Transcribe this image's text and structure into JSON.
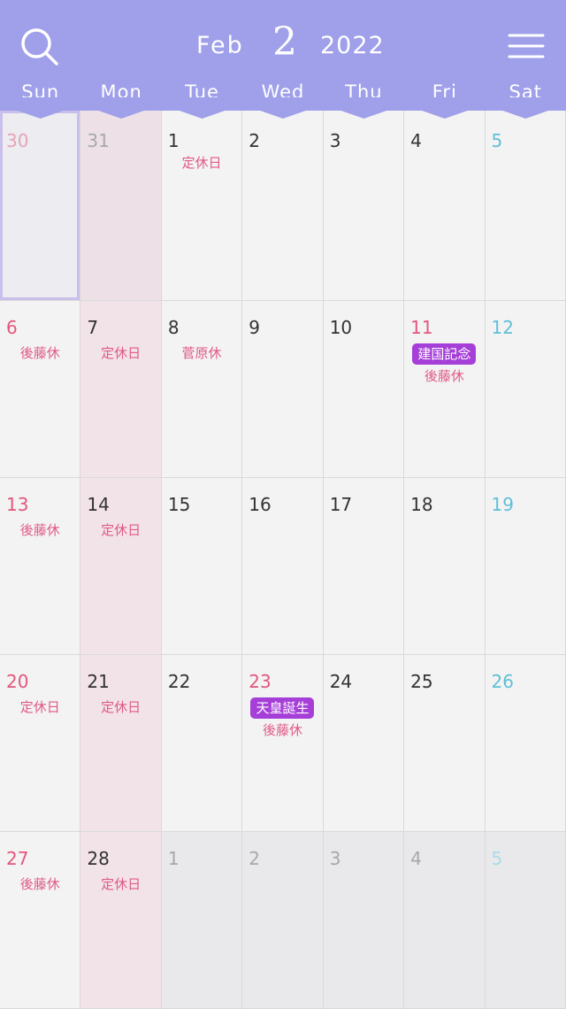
{
  "header": {
    "month": "Feb",
    "month_number": "2",
    "year": "2022",
    "search_icon": "search-icon",
    "menu_icon": "hamburger-menu-icon",
    "color": "#9f9fea"
  },
  "weekdays": [
    "Sun",
    "Mon",
    "Tue",
    "Wed",
    "Thu",
    "Fri",
    "Sat"
  ],
  "colors": {
    "sunday": "#e3577e",
    "saturday": "#5fc0d8",
    "event_text": "#e05a85",
    "holiday_badge": "#a63fd8"
  },
  "days": [
    {
      "d": "30",
      "out": true,
      "today": true,
      "events": []
    },
    {
      "d": "31",
      "out": true,
      "events": []
    },
    {
      "d": "1",
      "events": [
        "定休日"
      ]
    },
    {
      "d": "2",
      "events": []
    },
    {
      "d": "3",
      "events": []
    },
    {
      "d": "4",
      "events": []
    },
    {
      "d": "5",
      "events": []
    },
    {
      "d": "6",
      "events": [
        "後藤休"
      ]
    },
    {
      "d": "7",
      "events": [
        "定休日"
      ]
    },
    {
      "d": "8",
      "events": [
        "菅原休"
      ]
    },
    {
      "d": "9",
      "events": []
    },
    {
      "d": "10",
      "events": []
    },
    {
      "d": "11",
      "holiday": true,
      "badge": "建国記念",
      "events": [
        "後藤休"
      ]
    },
    {
      "d": "12",
      "events": []
    },
    {
      "d": "13",
      "events": [
        "後藤休"
      ]
    },
    {
      "d": "14",
      "events": [
        "定休日"
      ]
    },
    {
      "d": "15",
      "events": []
    },
    {
      "d": "16",
      "events": []
    },
    {
      "d": "17",
      "events": []
    },
    {
      "d": "18",
      "events": []
    },
    {
      "d": "19",
      "events": []
    },
    {
      "d": "20",
      "events": [
        "定休日"
      ]
    },
    {
      "d": "21",
      "events": [
        "定休日"
      ]
    },
    {
      "d": "22",
      "events": []
    },
    {
      "d": "23",
      "holiday": true,
      "badge": "天皇誕生",
      "events": [
        "後藤休"
      ]
    },
    {
      "d": "24",
      "events": []
    },
    {
      "d": "25",
      "events": []
    },
    {
      "d": "26",
      "events": []
    },
    {
      "d": "27",
      "events": [
        "後藤休"
      ]
    },
    {
      "d": "28",
      "events": [
        "定休日"
      ]
    },
    {
      "d": "1",
      "out": true,
      "events": []
    },
    {
      "d": "2",
      "out": true,
      "events": []
    },
    {
      "d": "3",
      "out": true,
      "events": []
    },
    {
      "d": "4",
      "out": true,
      "events": []
    },
    {
      "d": "5",
      "out": true,
      "events": []
    }
  ]
}
